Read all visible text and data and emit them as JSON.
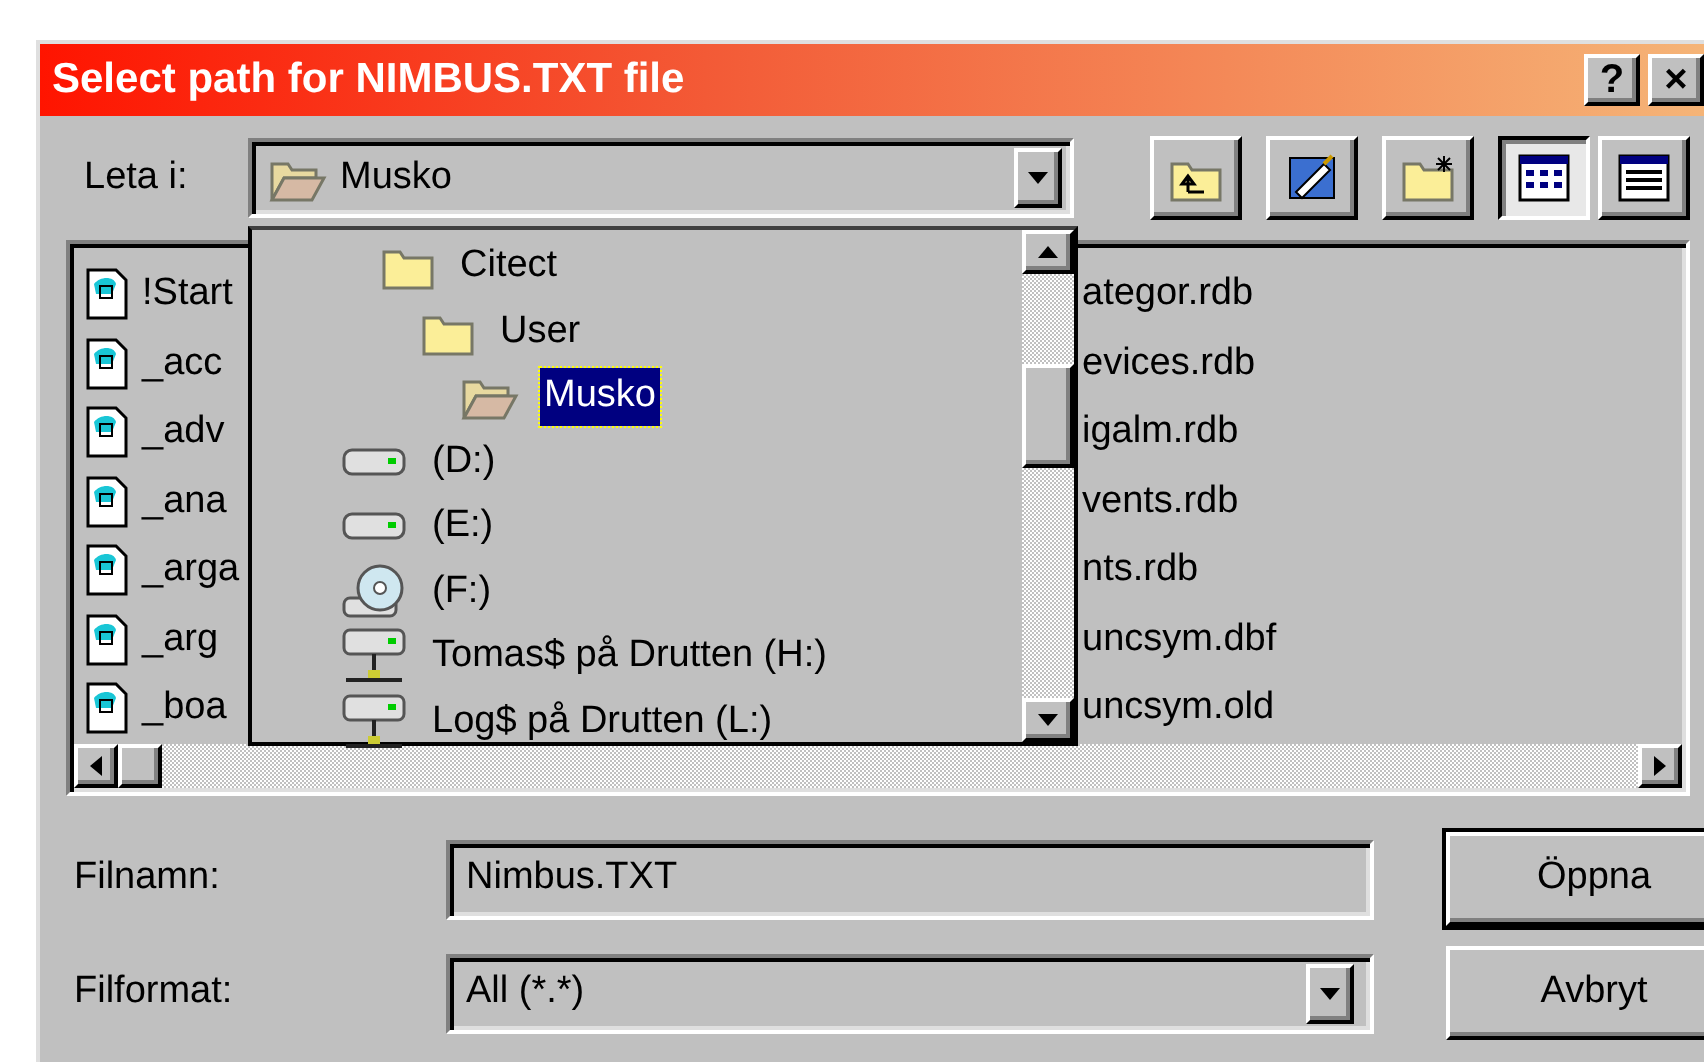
{
  "window": {
    "title": "Select path for NIMBUS.TXT file",
    "title_buttons": [
      "?",
      "×"
    ]
  },
  "look_in": {
    "label": "Leta i:",
    "value": "Musko"
  },
  "toolbar": [
    {
      "kind": "up-folder",
      "selected": false
    },
    {
      "kind": "desktop",
      "selected": false
    },
    {
      "kind": "new-folder",
      "selected": false
    },
    {
      "kind": "list-view",
      "selected": true
    },
    {
      "kind": "details-view",
      "selected": false
    }
  ],
  "look_in_menu": [
    {
      "label": "Citect",
      "kind": "folder",
      "selected": false,
      "children": [
        {
          "label": "User",
          "kind": "folder",
          "selected": false,
          "children": [
            {
              "label": "Musko",
              "kind": "open-folder",
              "selected": true
            }
          ]
        }
      ]
    },
    {
      "label": "(D:)",
      "kind": "drive",
      "selected": false
    },
    {
      "label": "(E:)",
      "kind": "drive",
      "selected": false
    },
    {
      "label": "(F:)",
      "kind": "cd-drive",
      "selected": false
    },
    {
      "label": "Tomas$ på Drutten (H:)",
      "kind": "network-drive",
      "selected": false
    },
    {
      "label": "Log$ på Drutten (L:)",
      "kind": "network-drive",
      "selected": false
    }
  ],
  "files": {
    "column_1": [
      "!Start",
      "_acc",
      "_adv",
      "_ana",
      "_arga",
      "_arg",
      "_boa"
    ],
    "column_2": [
      "ategor.rdb",
      "evices.rdb",
      "igalm.rdb",
      "vents.rdb",
      "nts.rdb",
      "uncsym.dbf",
      "uncsym.old"
    ]
  },
  "file_name": {
    "label": "Filnamn:",
    "value": "Nimbus.TXT"
  },
  "file_type": {
    "label": "Filformat:",
    "value": "All (*.*)"
  },
  "buttons": [
    {
      "label": "Öppna",
      "default": true
    },
    {
      "label": "Avbryt",
      "default": false
    }
  ]
}
